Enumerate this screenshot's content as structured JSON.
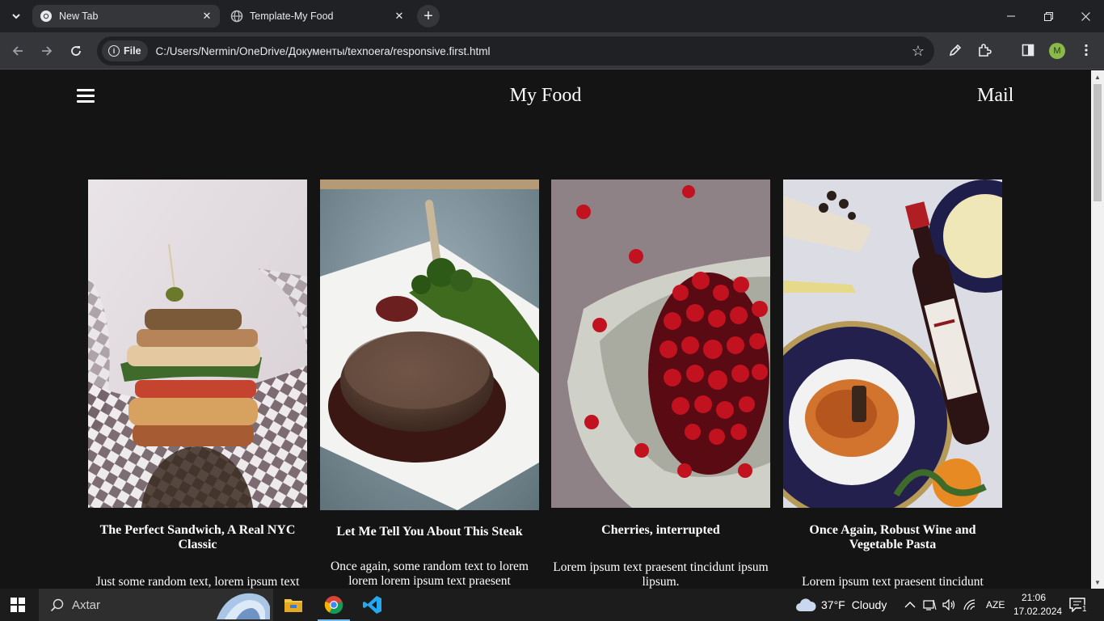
{
  "browser": {
    "tabs": [
      {
        "title": "New Tab",
        "active": true
      },
      {
        "title": "Template-My Food",
        "active": false
      }
    ],
    "address": {
      "chip_label": "File",
      "url": "C:/Users/Nermin/OneDrive/Документы/texnoera/responsive.first.html"
    },
    "profile_initial": "M"
  },
  "page": {
    "site_title": "My Food",
    "mail_label": "Mail",
    "cards": [
      {
        "title": "The Perfect Sandwich, A Real NYC Classic",
        "text": "Just some random text, lorem ipsum text"
      },
      {
        "title": "Let Me Tell You About This Steak",
        "text": "Once again, some random text to lorem lorem lorem ipsum text praesent"
      },
      {
        "title": "Cherries, interrupted",
        "text": "Lorem ipsum text praesent tincidunt ipsum lipsum."
      },
      {
        "title": "Once Again, Robust Wine and Vegetable Pasta",
        "text": "Lorem ipsum text praesent tincidunt"
      }
    ]
  },
  "taskbar": {
    "search_placeholder": "Axtar",
    "weather": {
      "temp": "37°F",
      "condition": "Cloudy"
    },
    "language": "AZE",
    "time": "21:06",
    "date": "17.02.2024",
    "notification_count": "1"
  }
}
